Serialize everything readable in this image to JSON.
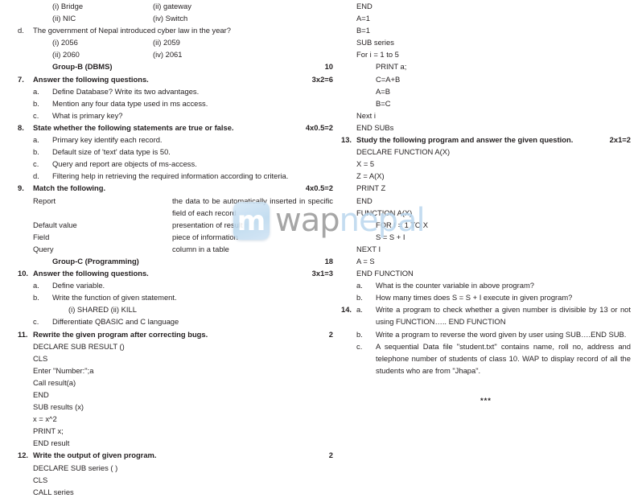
{
  "watermark": {
    "badge_glyph": "m",
    "text_part1": "wap",
    "text_part2": "nepal",
    "color_gray": "#9a9a9a",
    "color_blue": "#bcd8ef"
  },
  "left_column": {
    "q6_options": [
      {
        "a": "(i)  Bridge",
        "b": "(ii) gateway"
      },
      {
        "a": "(ii) NIC",
        "b": "(iv) Switch"
      }
    ],
    "q6d": {
      "letter": "d.",
      "text": "The government of Nepal introduced cyber law in the year?",
      "options": [
        {
          "a": "(i)  2056",
          "b": "(ii) 2059"
        },
        {
          "a": "(ii) 2060",
          "b": "(iv) 2061"
        }
      ]
    },
    "group_b": {
      "label": "Group-B (DBMS)",
      "marks": "10"
    },
    "q7": {
      "number": "7.",
      "title": "Answer the following questions.",
      "marks": "3x2=6",
      "items": [
        {
          "letter": "a.",
          "text": "Define Database? Write its two advantages."
        },
        {
          "letter": "b.",
          "text": "Mention any four data type used in ms access."
        },
        {
          "letter": "c.",
          "text": "What is primary key?"
        }
      ]
    },
    "q8": {
      "number": "8.",
      "title": "State whether the following statements are true or false.",
      "marks": "4x0.5=2",
      "items": [
        {
          "letter": "a.",
          "text": "Primary key identify each record."
        },
        {
          "letter": "b.",
          "text": "Default size of 'text' data type is 50."
        },
        {
          "letter": "c.",
          "text": "Query and report are objects of ms-access."
        },
        {
          "letter": "d.",
          "text": "Filtering help in retrieving the required information according to criteria."
        }
      ]
    },
    "q9": {
      "number": "9.",
      "title": "Match the following.",
      "marks": "4x0.5=2",
      "pairs": [
        {
          "left": "Report",
          "right": "the data to be automatically inserted in specific field of each record"
        },
        {
          "left": "Default value",
          "right": "presentation of result"
        },
        {
          "left": "Field",
          "right": "piece of information"
        },
        {
          "left": "Query",
          "right": "column in a table"
        }
      ]
    },
    "group_c": {
      "label": "Group-C (Programming)",
      "marks": "18"
    },
    "q10": {
      "number": "10.",
      "title": "Answer the following questions.",
      "marks": "3x1=3",
      "items": [
        {
          "letter": "a.",
          "text": "Define variable."
        },
        {
          "letter": "b.",
          "text": "Write the function of given statement."
        },
        {
          "letter": "",
          "text": "(i)  SHARED    (ii) KILL"
        },
        {
          "letter": "c.",
          "text": "Differentiate QBASIC and C language"
        }
      ]
    },
    "q11": {
      "number": "11.",
      "title": "Rewrite the given program after correcting bugs.",
      "marks": "2",
      "code": [
        "DECLARE SUB RESULT ()",
        "CLS",
        "Enter \"Number:\";a",
        "Call result(a)",
        "END",
        "SUB results (x)",
        "x = x^2",
        "PRINT x;",
        "END result"
      ]
    },
    "q12": {
      "number": "12.",
      "title": "Write the output of given program.",
      "marks": "2",
      "code": [
        "DECLARE SUB series ( )",
        "CLS",
        "CALL series"
      ]
    }
  },
  "right_column": {
    "q12_cont": {
      "code": [
        "END",
        "A=1",
        "B=1",
        "SUB series",
        "For i = 1 to 5"
      ],
      "code_indented": [
        "PRINT a;",
        "C=A+B",
        "A=B",
        "B=C"
      ],
      "code_tail": [
        "Next i",
        "END SUBs"
      ]
    },
    "q13": {
      "number": "13.",
      "title": "Study the following program and answer the given question.",
      "marks": "2x1=2",
      "code": [
        "DECLARE FUNCTION A(X)",
        "X = 5",
        "Z = A(X)",
        "PRINT Z",
        "END",
        "FUNCTION A(X)"
      ],
      "code_indented": [
        "FOR I = 1 TO X",
        "S = S + I"
      ],
      "code_tail": [
        "NEXT I",
        "A = S",
        "END FUNCTION"
      ],
      "items": [
        {
          "letter": "a.",
          "text": "What is the counter variable in above program?"
        },
        {
          "letter": "b.",
          "text": "How many times does S = S + I execute in given program?"
        }
      ]
    },
    "q14": {
      "number": "14.",
      "items": [
        {
          "letter": "a.",
          "text": "Write a program to check whether a given number is divisible by 13 or not using FUNCTION….. END FUNCTION"
        },
        {
          "letter": "b.",
          "text": "Write a program to reverse the word given by user using  SUB….END SUB."
        },
        {
          "letter": "c.",
          "text": "A sequential Data file \"student.txt\" contains name, roll no, address and telephone number of students of class 10. WAP to display record of all the students who are from \"Jhapa\"."
        }
      ]
    },
    "end_marker": "***"
  }
}
